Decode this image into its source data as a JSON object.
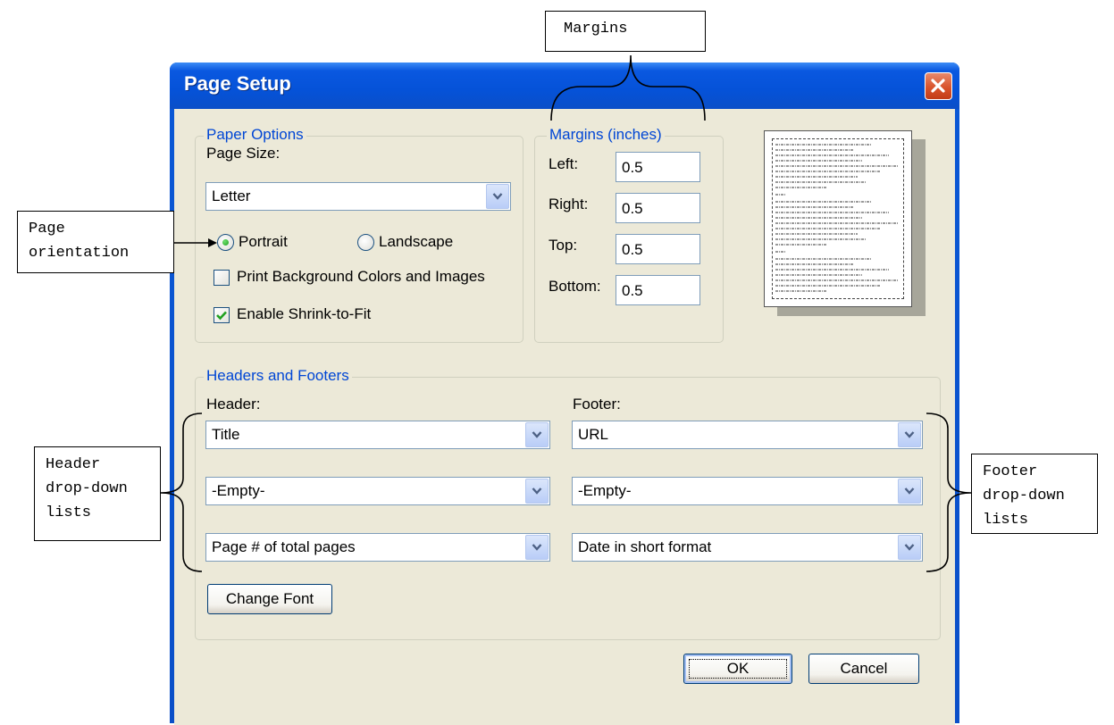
{
  "window": {
    "title": "Page Setup"
  },
  "paper_options": {
    "legend": "Paper Options",
    "page_size_label": "Page Size:",
    "page_size_value": "Letter",
    "orientation": {
      "portrait_label": "Portrait",
      "landscape_label": "Landscape",
      "selected": "Portrait"
    },
    "print_background": {
      "label": "Print Background Colors and Images",
      "checked": false
    },
    "shrink_to_fit": {
      "label": "Enable Shrink-to-Fit",
      "checked": true
    }
  },
  "margins": {
    "legend": "Margins (inches)",
    "left_label": "Left:",
    "left_value": "0.5",
    "right_label": "Right:",
    "right_value": "0.5",
    "top_label": "Top:",
    "top_value": "0.5",
    "bottom_label": "Bottom:",
    "bottom_value": "0.5"
  },
  "headers_footers": {
    "legend": "Headers and Footers",
    "header_label": "Header:",
    "footer_label": "Footer:",
    "header_values": [
      "Title",
      "-Empty-",
      "Page # of total pages"
    ],
    "footer_values": [
      "URL",
      "-Empty-",
      "Date in short format"
    ],
    "change_font_label": "Change Font"
  },
  "buttons": {
    "ok": "OK",
    "cancel": "Cancel"
  },
  "annotations": {
    "margins": "Margins",
    "page_orientation": "Page\norientation",
    "header_lists": "Header\ndrop-down\nlists",
    "footer_lists": "Footer\ndrop-down\nlists"
  },
  "colors": {
    "titlebar": "#0a58e0",
    "dialog_bg": "#ece9d8",
    "legend_text": "#0046d5",
    "close_button": "#d9532c"
  }
}
